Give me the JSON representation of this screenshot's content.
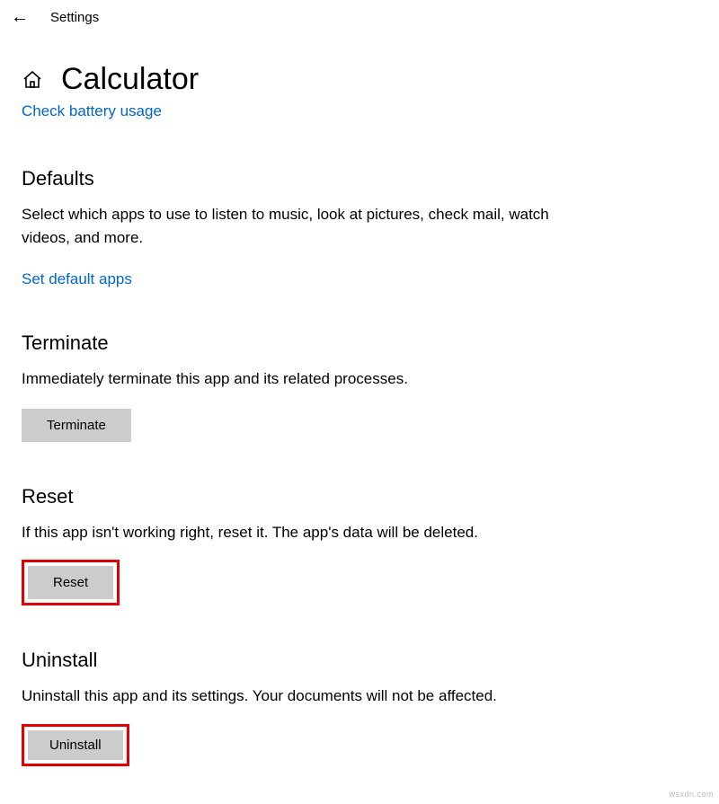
{
  "topbar": {
    "title": "Settings"
  },
  "header": {
    "app_name": "Calculator"
  },
  "cut_link": "Check battery usage",
  "defaults": {
    "heading": "Defaults",
    "description": "Select which apps to use to listen to music, look at pictures, check mail, watch videos, and more.",
    "link": "Set default apps"
  },
  "terminate": {
    "heading": "Terminate",
    "description": "Immediately terminate this app and its related processes.",
    "button": "Terminate"
  },
  "reset": {
    "heading": "Reset",
    "description": "If this app isn't working right, reset it. The app's data will be deleted.",
    "button": "Reset"
  },
  "uninstall": {
    "heading": "Uninstall",
    "description": "Uninstall this app and its settings. Your documents will not be affected.",
    "button": "Uninstall"
  },
  "watermark": "wsxdn.com"
}
